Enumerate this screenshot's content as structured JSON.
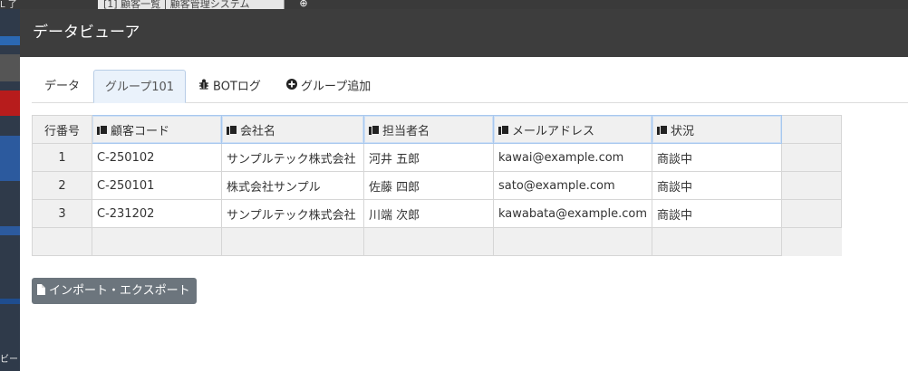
{
  "background": {
    "tab_label": "[1] 顧客一覧 | 顧客管理システム",
    "brand_text": "L\n了",
    "bottom_text": "ビー"
  },
  "modal": {
    "title": "データビューア"
  },
  "tabs": [
    {
      "label": "データ",
      "icon": ""
    },
    {
      "label": "グループ101",
      "icon": ""
    },
    {
      "label": "BOTログ",
      "icon": "bug-icon"
    },
    {
      "label": "グループ追加",
      "icon": "plus-circle-icon"
    }
  ],
  "grid": {
    "rownum_header": "行番号",
    "columns": [
      "顧客コード",
      "会社名",
      "担当者名",
      "メールアドレス",
      "状況"
    ],
    "rows": [
      {
        "num": "1",
        "cells": [
          "C-250102",
          "サンプルテック株式会社",
          "河井 五郎",
          "kawai@example.com",
          "商談中"
        ]
      },
      {
        "num": "2",
        "cells": [
          "C-250101",
          "株式会社サンプル",
          "佐藤 四郎",
          "sato@example.com",
          "商談中"
        ]
      },
      {
        "num": "3",
        "cells": [
          "C-231202",
          "サンプルテック株式会社",
          "川端 次郎",
          "kawabata@example.com",
          "商談中"
        ]
      }
    ]
  },
  "import_export_button": "インポート・エクスポート",
  "colors": {
    "header_bg": "#3d3d3d",
    "active_tab_bg": "#eaf2fb",
    "button_bg": "#6c757d"
  }
}
